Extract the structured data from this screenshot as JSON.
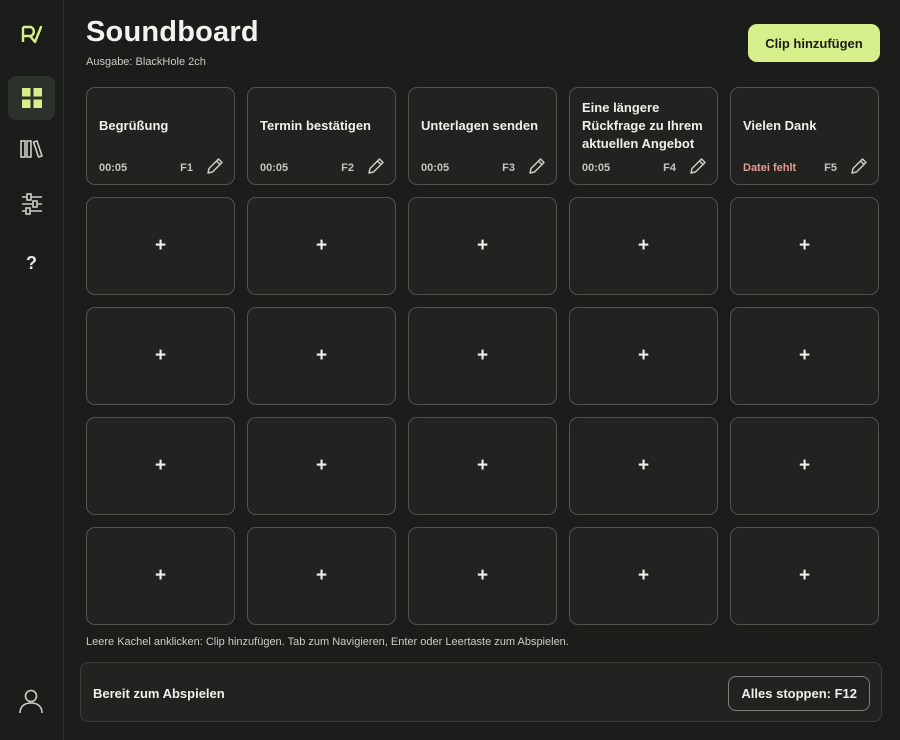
{
  "app": {
    "title": "Soundboard",
    "output_label": "Ausgabe: BlackHole 2ch",
    "accent_color": "#d7ef8a",
    "missing_color": "#e79a90"
  },
  "sidebar": {
    "items": [
      {
        "name": "grid",
        "icon": "grid-icon",
        "active": true
      },
      {
        "name": "library",
        "icon": "library-icon",
        "active": false
      },
      {
        "name": "settings",
        "icon": "sliders-icon",
        "active": false
      },
      {
        "name": "help",
        "icon": "help-icon",
        "label": "?",
        "active": false
      }
    ],
    "user_icon": "user-icon"
  },
  "toolbar": {
    "add_clip_label": "Clip hinzufügen"
  },
  "clips": [
    {
      "title": "Begrüßung",
      "duration": "00:05",
      "key": "F1",
      "missing": false
    },
    {
      "title": "Termin bestätigen",
      "duration": "00:05",
      "key": "F2",
      "missing": false
    },
    {
      "title": "Unterlagen senden",
      "duration": "00:05",
      "key": "F3",
      "missing": false
    },
    {
      "title": "Eine längere Rückfrage zu Ihrem aktuellen Angebot",
      "duration": "00:05",
      "key": "F4",
      "missing": false
    },
    {
      "title": "Vielen Dank",
      "duration": "Datei fehlt",
      "key": "F5",
      "missing": true
    }
  ],
  "empty_tile_label": "+",
  "hint": "Leere Kachel anklicken: Clip hinzufügen. Tab zum Navigieren, Enter oder Leertaste zum Abspielen.",
  "status": {
    "text": "Bereit zum Abspielen",
    "stop_label": "Alles stoppen: F12"
  }
}
